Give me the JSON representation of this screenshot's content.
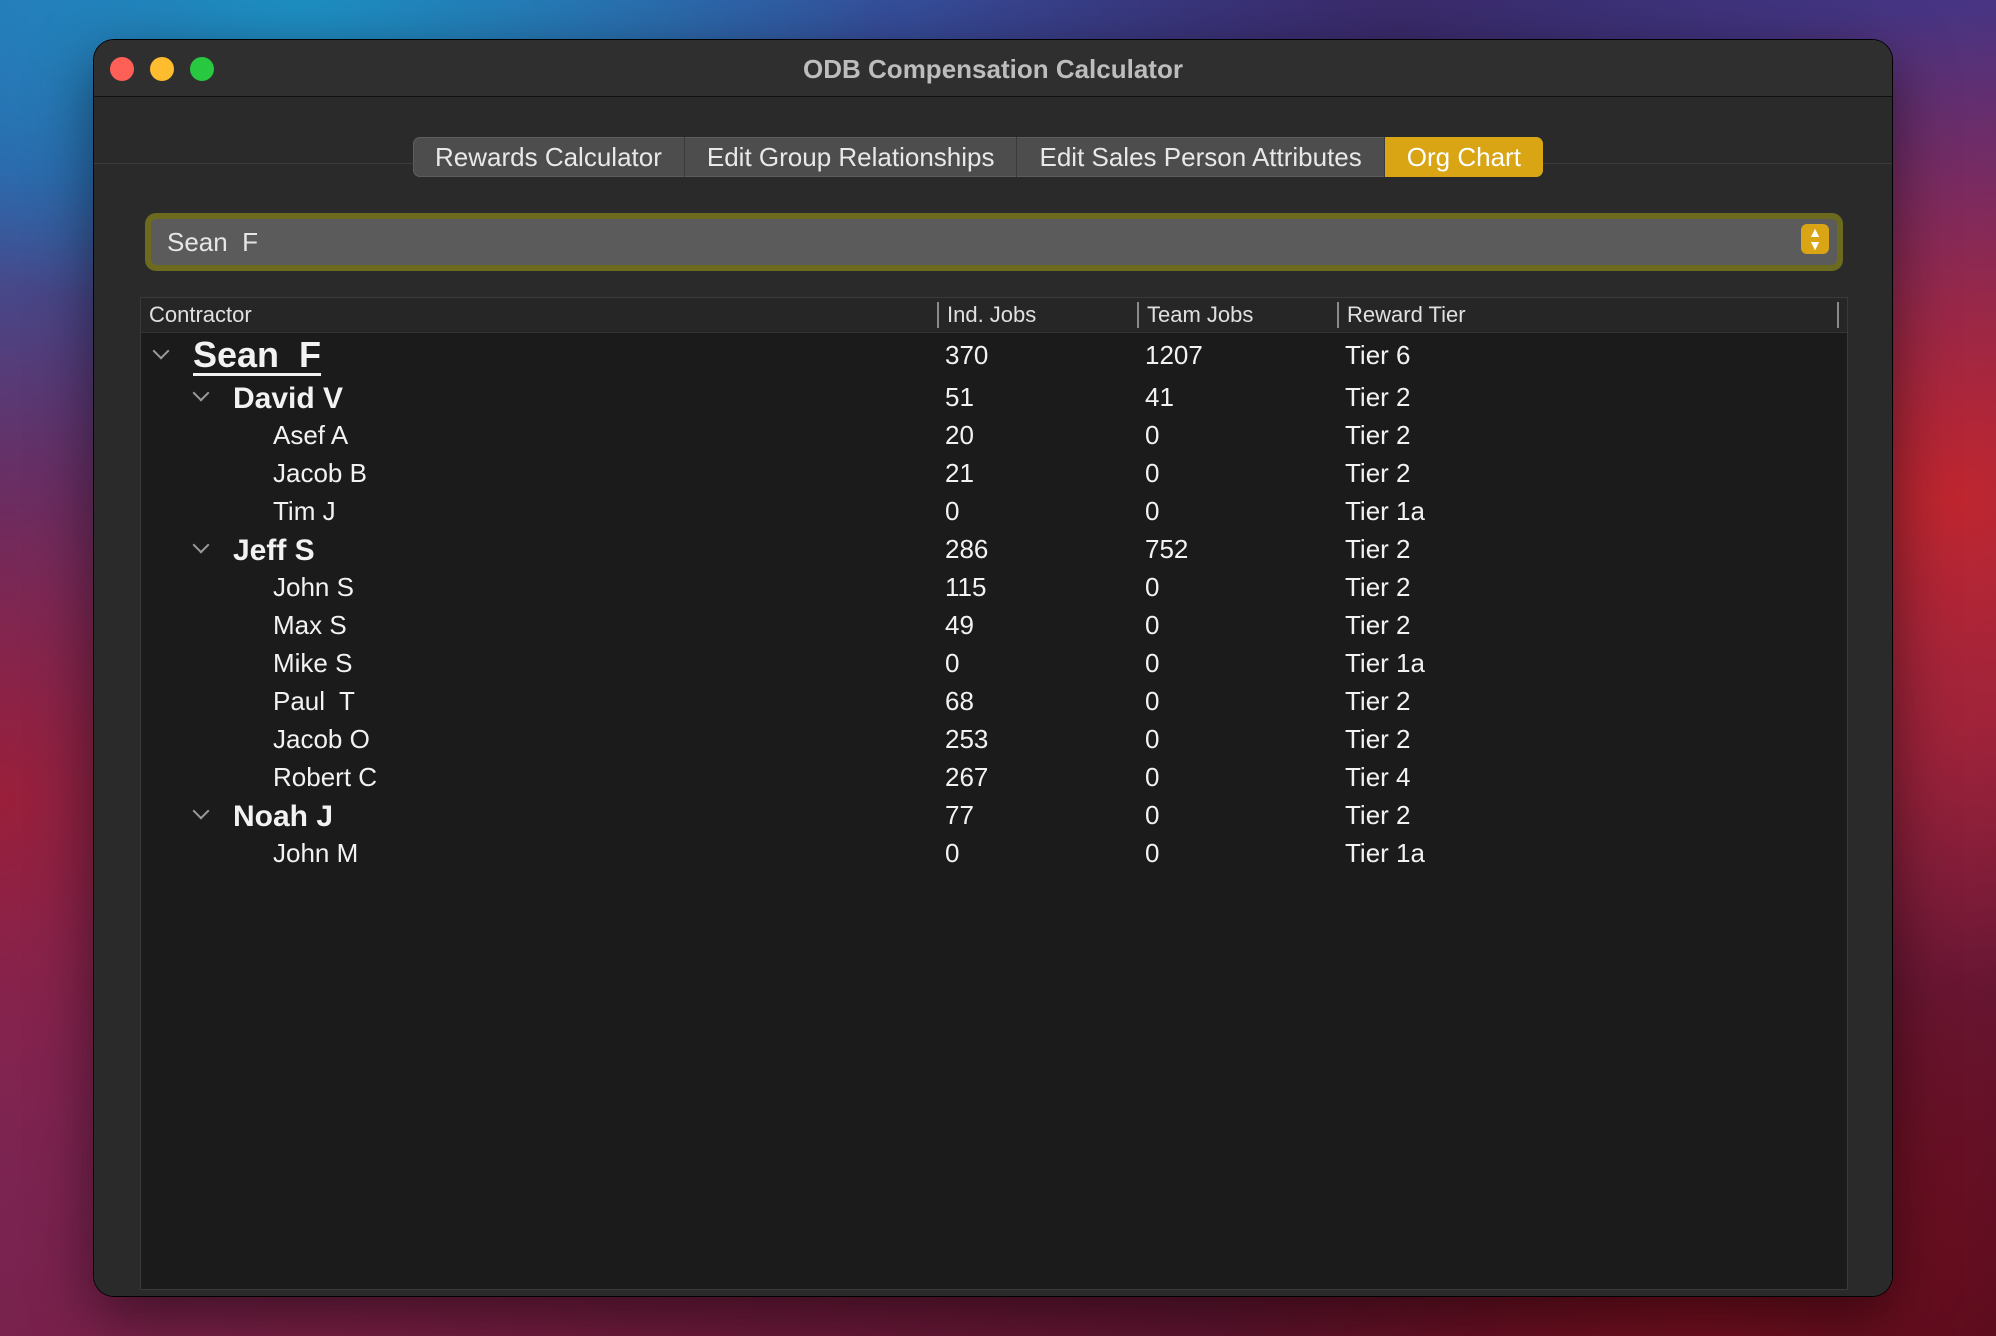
{
  "window": {
    "title": "ODB Compensation Calculator"
  },
  "tabs": [
    {
      "label": "Rewards Calculator",
      "active": false
    },
    {
      "label": "Edit Group Relationships",
      "active": false
    },
    {
      "label": "Edit Sales Person Attributes",
      "active": false
    },
    {
      "label": "Org Chart",
      "active": true
    }
  ],
  "selector": {
    "value": "Sean  F"
  },
  "table": {
    "columns": [
      "Contractor",
      "Ind. Jobs",
      "Team Jobs",
      "Reward Tier"
    ],
    "rows": [
      {
        "name": "Sean  F",
        "ind_jobs": "370",
        "team_jobs": "1207",
        "tier": "Tier 6",
        "level": 0,
        "expanded": true
      },
      {
        "name": "David V",
        "ind_jobs": "51",
        "team_jobs": "41",
        "tier": "Tier 2",
        "level": 1,
        "expanded": true
      },
      {
        "name": "Asef A",
        "ind_jobs": "20",
        "team_jobs": "0",
        "tier": "Tier 2",
        "level": 2
      },
      {
        "name": "Jacob B",
        "ind_jobs": "21",
        "team_jobs": "0",
        "tier": "Tier 2",
        "level": 2
      },
      {
        "name": "Tim J",
        "ind_jobs": "0",
        "team_jobs": "0",
        "tier": "Tier 1a",
        "level": 2
      },
      {
        "name": "Jeff S",
        "ind_jobs": "286",
        "team_jobs": "752",
        "tier": "Tier 2",
        "level": 1,
        "expanded": true
      },
      {
        "name": "John S",
        "ind_jobs": "115",
        "team_jobs": "0",
        "tier": "Tier 2",
        "level": 2
      },
      {
        "name": "Max S",
        "ind_jobs": "49",
        "team_jobs": "0",
        "tier": "Tier 2",
        "level": 2
      },
      {
        "name": "Mike S",
        "ind_jobs": "0",
        "team_jobs": "0",
        "tier": "Tier 1a",
        "level": 2
      },
      {
        "name": "Paul  T",
        "ind_jobs": "68",
        "team_jobs": "0",
        "tier": "Tier 2",
        "level": 2
      },
      {
        "name": "Jacob O",
        "ind_jobs": "253",
        "team_jobs": "0",
        "tier": "Tier 2",
        "level": 2
      },
      {
        "name": "Robert C",
        "ind_jobs": "267",
        "team_jobs": "0",
        "tier": "Tier 4",
        "level": 2
      },
      {
        "name": "Noah J",
        "ind_jobs": "77",
        "team_jobs": "0",
        "tier": "Tier 2",
        "level": 1,
        "expanded": true
      },
      {
        "name": "John M",
        "ind_jobs": "0",
        "team_jobs": "0",
        "tier": "Tier 1a",
        "level": 2
      }
    ]
  },
  "colors": {
    "accent": "#d9a515",
    "focus_ring": "#6b6a1e"
  },
  "icons": {
    "disclosure": "chevron-down-icon",
    "popup": "up-down-stepper-icon"
  }
}
